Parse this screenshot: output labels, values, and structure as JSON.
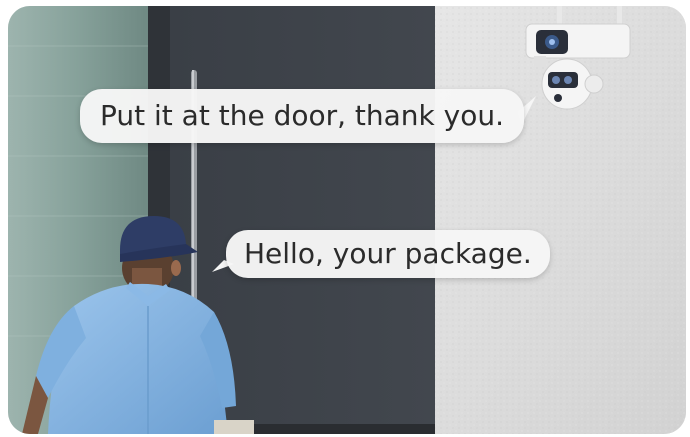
{
  "speech": {
    "camera_line": "Put it at the door, thank you.",
    "courier_line": "Hello, your package."
  },
  "colors": {
    "wall": "#dedede",
    "door": "#3c4148",
    "glass": "#8fa8a2",
    "shirt": "#7fb0df",
    "cap": "#2e3d66"
  },
  "icons": [
    "security-camera-icon"
  ]
}
